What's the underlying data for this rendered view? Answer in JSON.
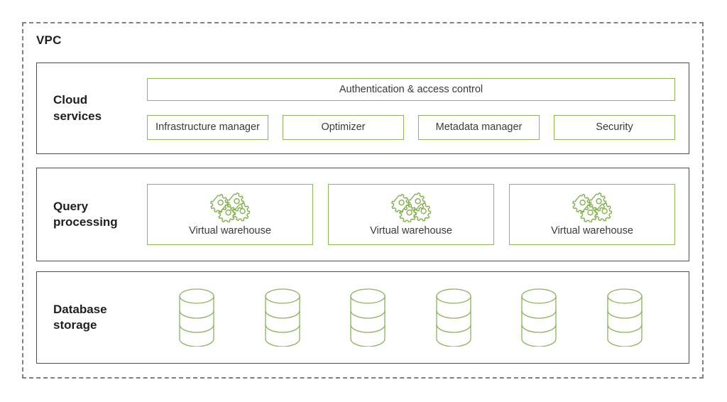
{
  "diagram": {
    "title": "VPC",
    "accent_color": "#8cb25c",
    "boundary_color": "#808080",
    "layer_border_color": "#4d4d4d",
    "text_color": "#3a3a3a"
  },
  "layers": [
    {
      "id": "cloud-services",
      "label": "Cloud\nservices",
      "label_line1": "Cloud",
      "label_line2": "services",
      "banner": {
        "label": "Authentication & access control"
      },
      "services": [
        {
          "label": "Infrastructure manager"
        },
        {
          "label": "Optimizer"
        },
        {
          "label": "Metadata manager"
        },
        {
          "label": "Security"
        }
      ]
    },
    {
      "id": "query-processing",
      "label_line1": "Query",
      "label_line2": "processing",
      "warehouses": [
        {
          "label": "Virtual warehouse",
          "icon": "gears-icon"
        },
        {
          "label": "Virtual warehouse",
          "icon": "gears-icon"
        },
        {
          "label": "Virtual warehouse",
          "icon": "gears-icon"
        }
      ]
    },
    {
      "id": "database-storage",
      "label_line1": "Database",
      "label_line2": "storage",
      "storage_units": [
        {
          "icon": "database-cylinder-icon"
        },
        {
          "icon": "database-cylinder-icon"
        },
        {
          "icon": "database-cylinder-icon"
        },
        {
          "icon": "database-cylinder-icon"
        },
        {
          "icon": "database-cylinder-icon"
        },
        {
          "icon": "database-cylinder-icon"
        }
      ]
    }
  ]
}
